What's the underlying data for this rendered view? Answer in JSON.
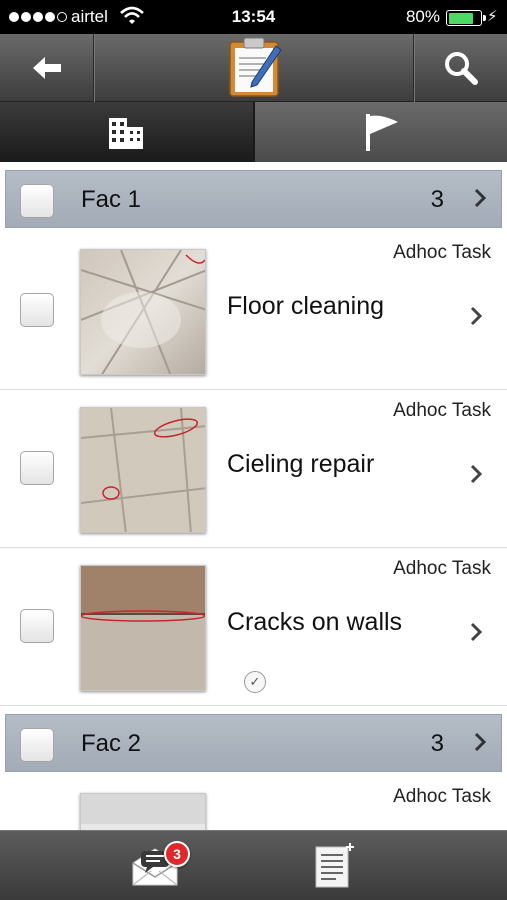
{
  "status_bar": {
    "signal_bars": 5,
    "signal_filled": 4,
    "carrier": "airtel",
    "time": "13:54",
    "battery_percent": "80%",
    "battery_level": 0.8,
    "colors": {
      "battery_fill": "#4cd964"
    }
  },
  "nav": {
    "back_icon": "back-arrow-icon",
    "logo_icon": "clipboard-pen-icon",
    "search_icon": "search-icon"
  },
  "tabs": [
    {
      "icon": "building-icon",
      "selected": true
    },
    {
      "icon": "flag-icon",
      "selected": false
    }
  ],
  "groups": [
    {
      "name": "Fac 1",
      "count": "3",
      "tasks": [
        {
          "type": "Adhoc Task",
          "title": "Floor cleaning"
        },
        {
          "type": "Adhoc Task",
          "title": "Cieling repair"
        },
        {
          "type": "Adhoc Task",
          "title": "Cracks on walls"
        }
      ]
    },
    {
      "name": "Fac 2",
      "count": "3",
      "tasks": [
        {
          "type": "Adhoc Task",
          "title": ""
        }
      ]
    }
  ],
  "toolbar": {
    "messages_icon": "envelope-chat-icon",
    "messages_badge": "3",
    "new_task_icon": "new-document-icon",
    "colors": {
      "badge": "#e0282a"
    }
  }
}
